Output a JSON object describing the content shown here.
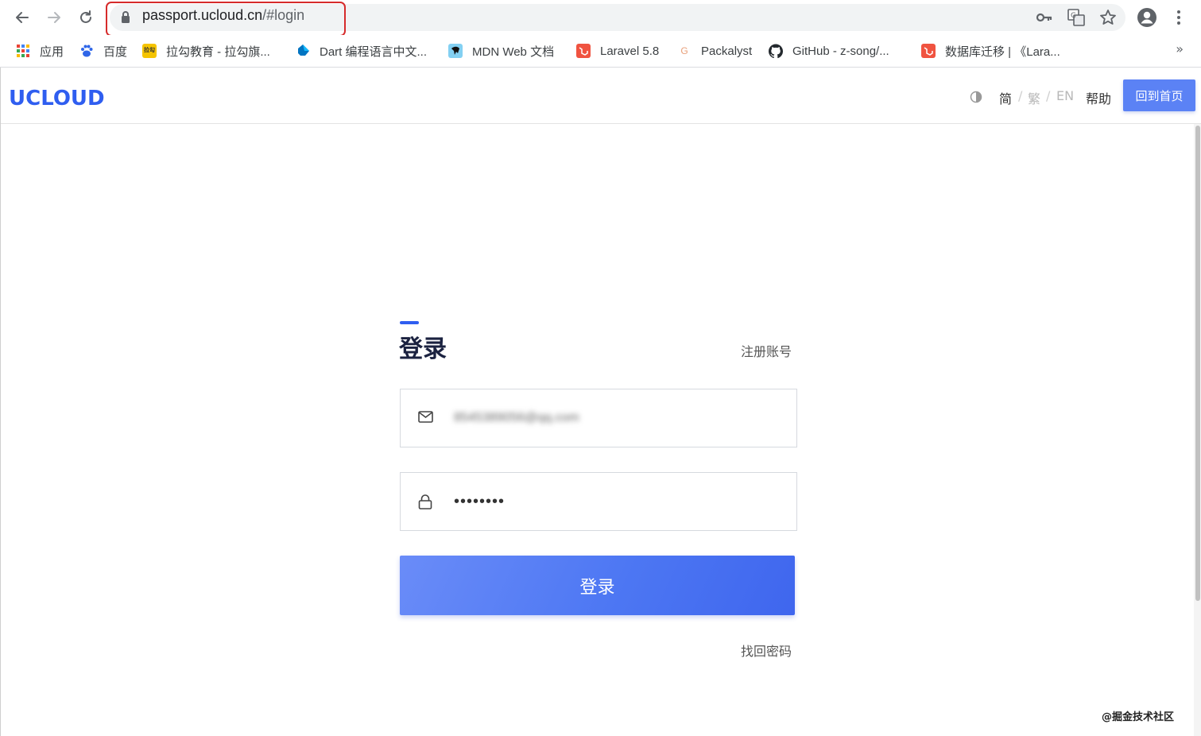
{
  "browser": {
    "url_host": "passport.ucloud.cn",
    "url_path": "/#login"
  },
  "bookmarks": [
    {
      "label": "应用",
      "icon": "apps-grid-icon"
    },
    {
      "label": "百度",
      "icon": "baidu-paw-icon"
    },
    {
      "label": "拉勾教育 - 拉勾旗...",
      "icon": "lagou-icon"
    },
    {
      "label": "Dart 编程语言中文...",
      "icon": "dart-icon"
    },
    {
      "label": "MDN Web 文档",
      "icon": "mdn-icon"
    },
    {
      "label": "Laravel 5.8",
      "icon": "laravel-icon"
    },
    {
      "label": "Packalyst",
      "icon": "packalyst-icon"
    },
    {
      "label": "GitHub - z-song/...",
      "icon": "github-icon"
    },
    {
      "label": "数据库迁移 | 《Lara...",
      "icon": "laravel-icon"
    }
  ],
  "bookmarks_more": "»",
  "header": {
    "logo": "UCLOUD",
    "lang_simplified": "简",
    "lang_traditional": "繁",
    "lang_english": "EN",
    "lang_sep": "/",
    "help": "帮助",
    "home_button": "回到首页"
  },
  "login": {
    "title": "登录",
    "register_link": "注册账号",
    "email_value": "8545389056@qq.com",
    "password_value": "••••••••",
    "submit_label": "登录",
    "forgot_link": "找回密码"
  },
  "watermark": "@掘金技术社区",
  "colors": {
    "accent": "#2f5ef0",
    "button": "#5b82f5",
    "url_highlight": "#d62b2b"
  }
}
